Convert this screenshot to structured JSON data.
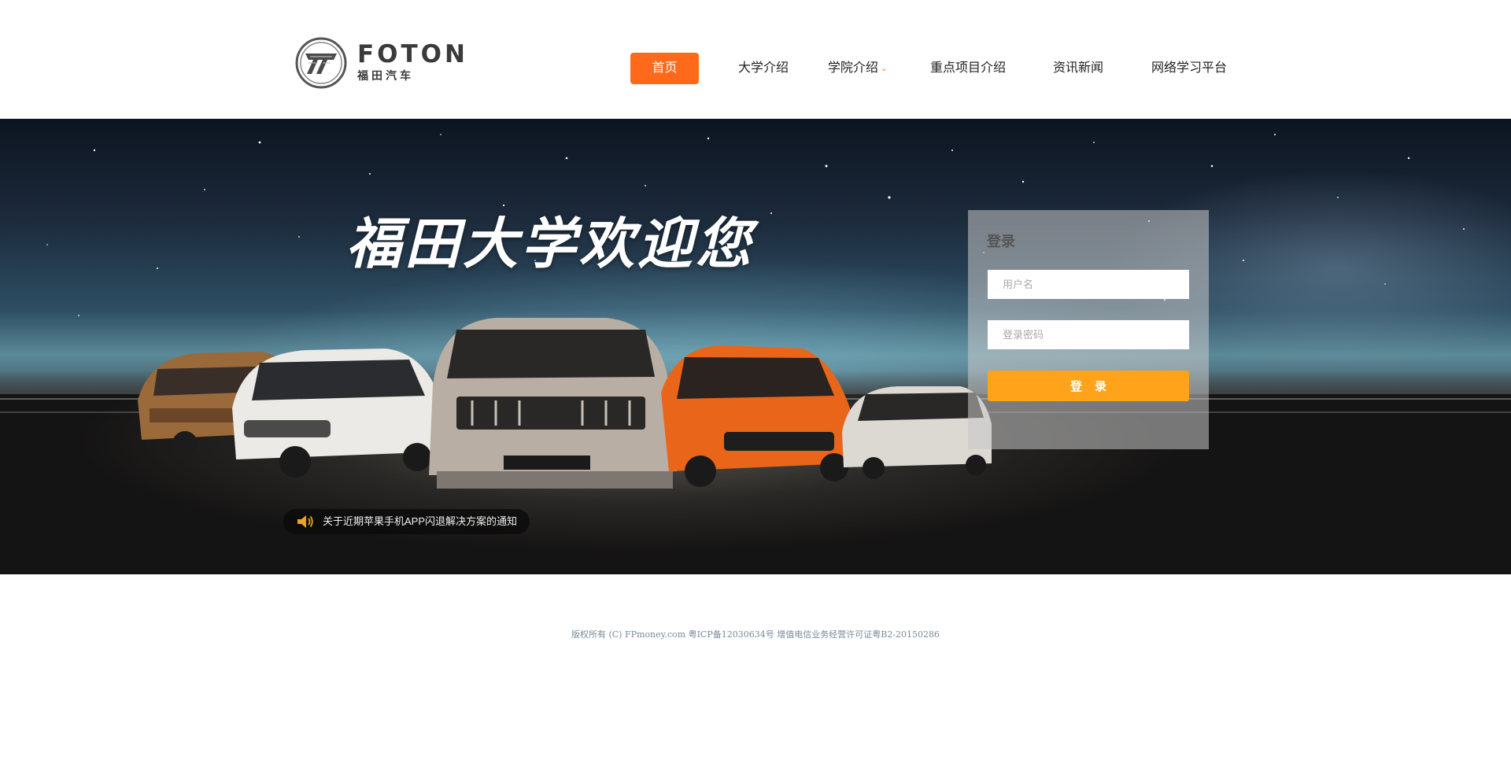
{
  "brand": {
    "word": "FOTON",
    "cn": "福田汽车"
  },
  "nav": {
    "items": [
      {
        "label": "首页",
        "active": true
      },
      {
        "label": "大学介绍"
      },
      {
        "label": "学院介绍",
        "has_dropdown": true
      },
      {
        "label": "重点项目介绍"
      },
      {
        "label": "资讯新闻"
      },
      {
        "label": "网络学习平台"
      }
    ]
  },
  "banner": {
    "welcome": "福田大学欢迎您",
    "notice": "关于近期苹果手机APP闪退解决方案的通知"
  },
  "login": {
    "title": "登录",
    "username_placeholder": "用户名",
    "password_placeholder": "登录密码",
    "submit_label": "登录"
  },
  "footer": {
    "text": "版权所有 (C) FPmoney.com 粤ICP备12030634号 增值电信业务经营许可证粤B2-20150286"
  },
  "colors": {
    "accent": "#ff6a1a",
    "login_button": "#ffa31a",
    "footer_text": "#7a8a9a"
  },
  "icons": {
    "nav_dropdown": "chevron-down-icon",
    "notice": "speaker-icon"
  }
}
